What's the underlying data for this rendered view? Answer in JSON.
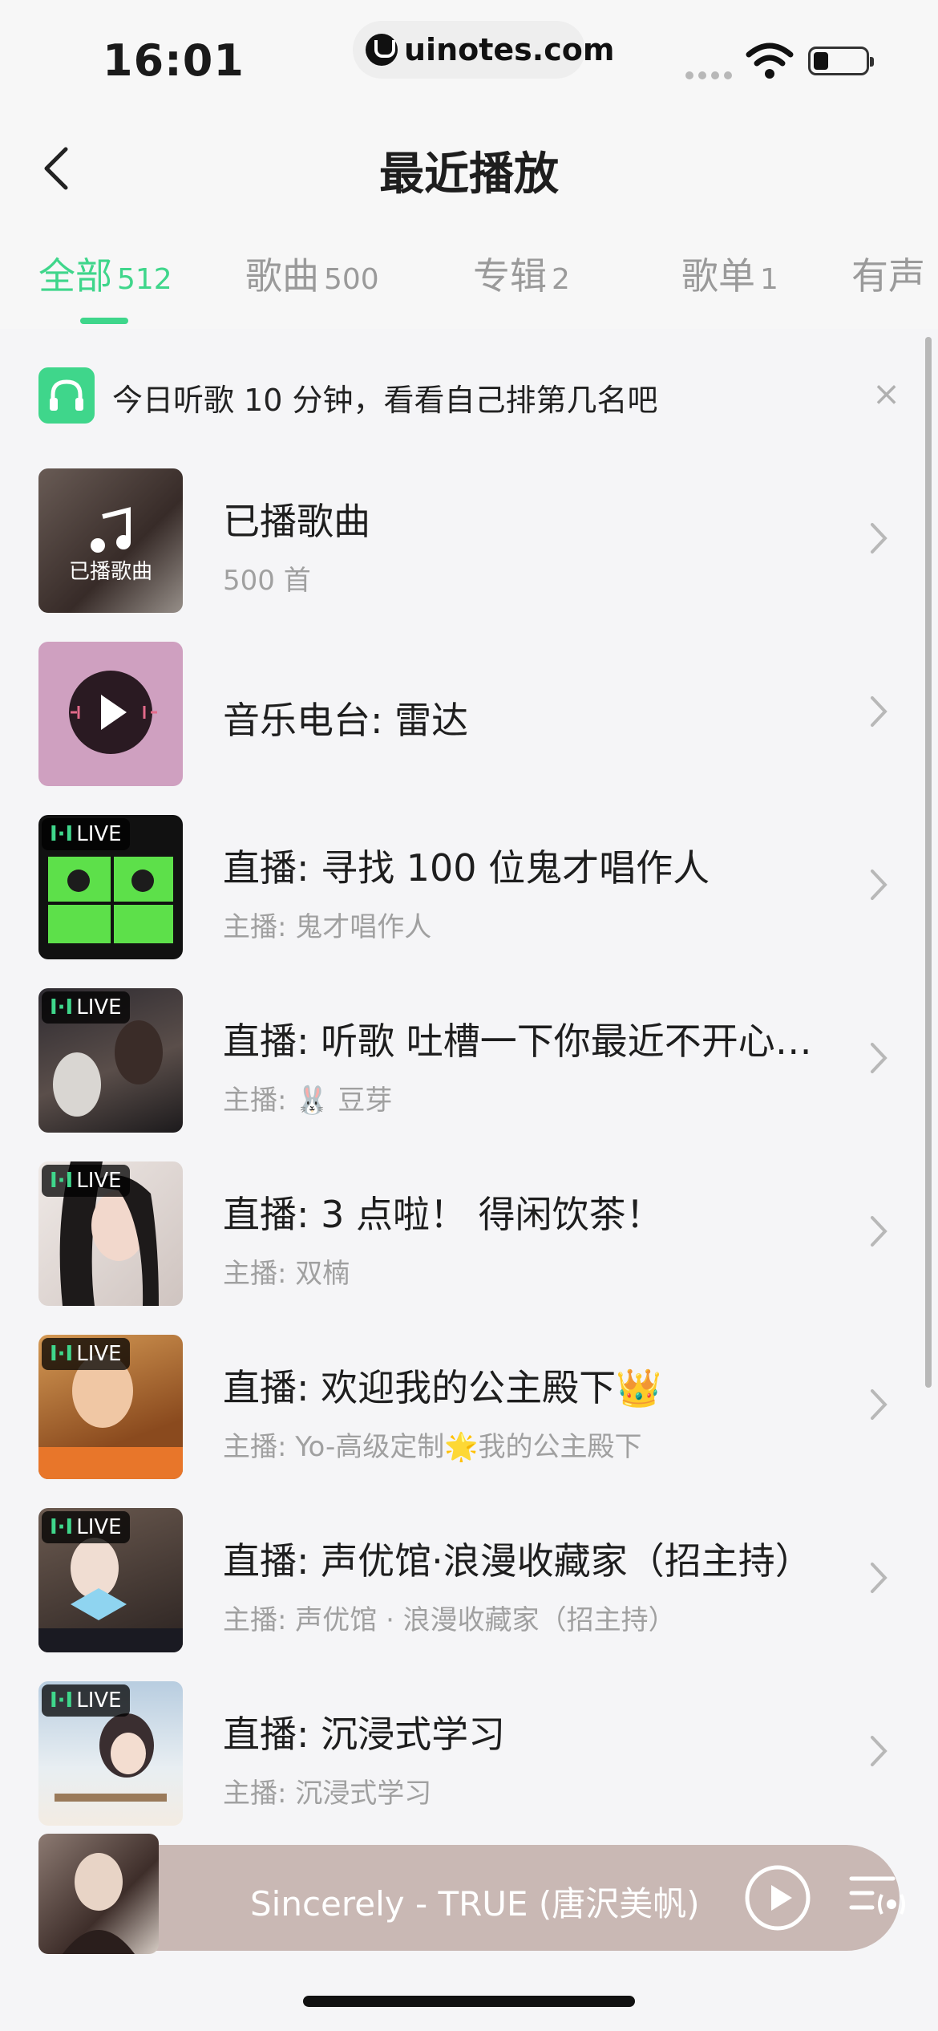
{
  "status_bar": {
    "time": "16:01",
    "url": "uinotes.com"
  },
  "header": {
    "title": "最近播放"
  },
  "tabs": [
    {
      "label": "全部",
      "count": "512"
    },
    {
      "label": "歌曲",
      "count": "500"
    },
    {
      "label": "专辑",
      "count": "2"
    },
    {
      "label": "歌单",
      "count": "1"
    },
    {
      "label": "有声",
      "count": ""
    }
  ],
  "banner": {
    "text": "今日听歌 10 分钟，看看自己排第几名吧",
    "close": "×"
  },
  "list": [
    {
      "title": "已播歌曲",
      "subtitle": "500 首",
      "cover_label": "已播歌曲"
    },
    {
      "title": "音乐电台: 雷达",
      "subtitle": ""
    },
    {
      "title": "直播: 寻找 100 位鬼才唱作人",
      "subtitle": "主播: 鬼才唱作人",
      "badge": "LIVE"
    },
    {
      "title": "直播: 听歌 吐槽一下你最近不开心…",
      "subtitle": "主播: 🐰 豆芽",
      "badge": "LIVE"
    },
    {
      "title": "直播: 3 点啦！ 得闲饮茶！",
      "subtitle": "主播: 双楠",
      "badge": "LIVE"
    },
    {
      "title": "直播: 欢迎我的公主殿下👑",
      "subtitle": "主播: Yo-高级定制🌟我的公主殿下",
      "badge": "LIVE"
    },
    {
      "title": "直播: 声优馆·浪漫收藏家（招主持）",
      "subtitle": "主播: 声优馆 · 浪漫收藏家（招主持）",
      "badge": "LIVE"
    },
    {
      "title": "直播: 沉浸式学习",
      "subtitle": "主播: 沉浸式学习",
      "badge": "LIVE"
    }
  ],
  "player": {
    "song": "Sincerely - TRUE (唐沢美帆)"
  },
  "colors": {
    "accent": "#3fd68b",
    "player_bg": "#c9b8b4"
  }
}
